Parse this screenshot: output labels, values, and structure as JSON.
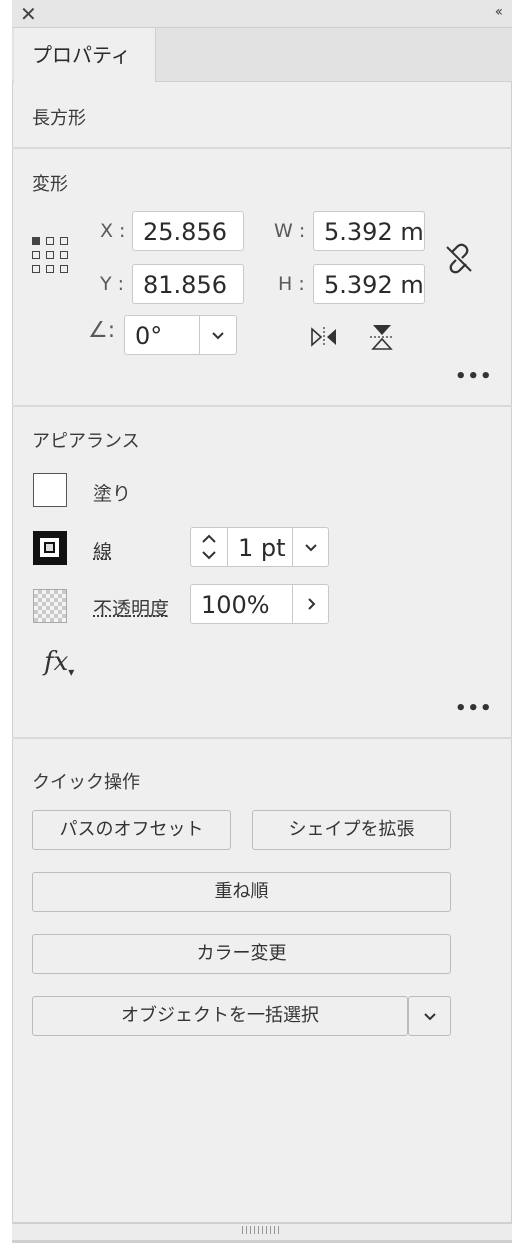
{
  "tab": {
    "label": "プロパティ"
  },
  "object_type": "長方形",
  "transform": {
    "title": "変形",
    "x_label": "X :",
    "y_label": "Y :",
    "w_label": "W :",
    "h_label": "H :",
    "x_value": "25.856",
    "y_value": "81.856",
    "w_value": "5.392 m",
    "h_value": "5.392 m",
    "angle_label": "∠:",
    "angle_value": "0°"
  },
  "appearance": {
    "title": "アピアランス",
    "fill_label": "塗り",
    "stroke_label": "線",
    "stroke_value": "1 pt",
    "opacity_label": "不透明度",
    "opacity_value": "100%",
    "fx_label": "fx"
  },
  "quick_actions": {
    "title": "クイック操作",
    "offset_path": "パスのオフセット",
    "expand_shape": "シェイプを拡張",
    "arrange": "重ね順",
    "recolor": "カラー変更",
    "select_same": "オブジェクトを一括選択"
  },
  "icons": {
    "close": "close-icon",
    "collapse": "double-chevron-icon",
    "link": "constrain-proportions-icon",
    "flip_h": "flip-horizontal-icon",
    "flip_v": "flip-vertical-icon",
    "more": "more-options-icon"
  }
}
